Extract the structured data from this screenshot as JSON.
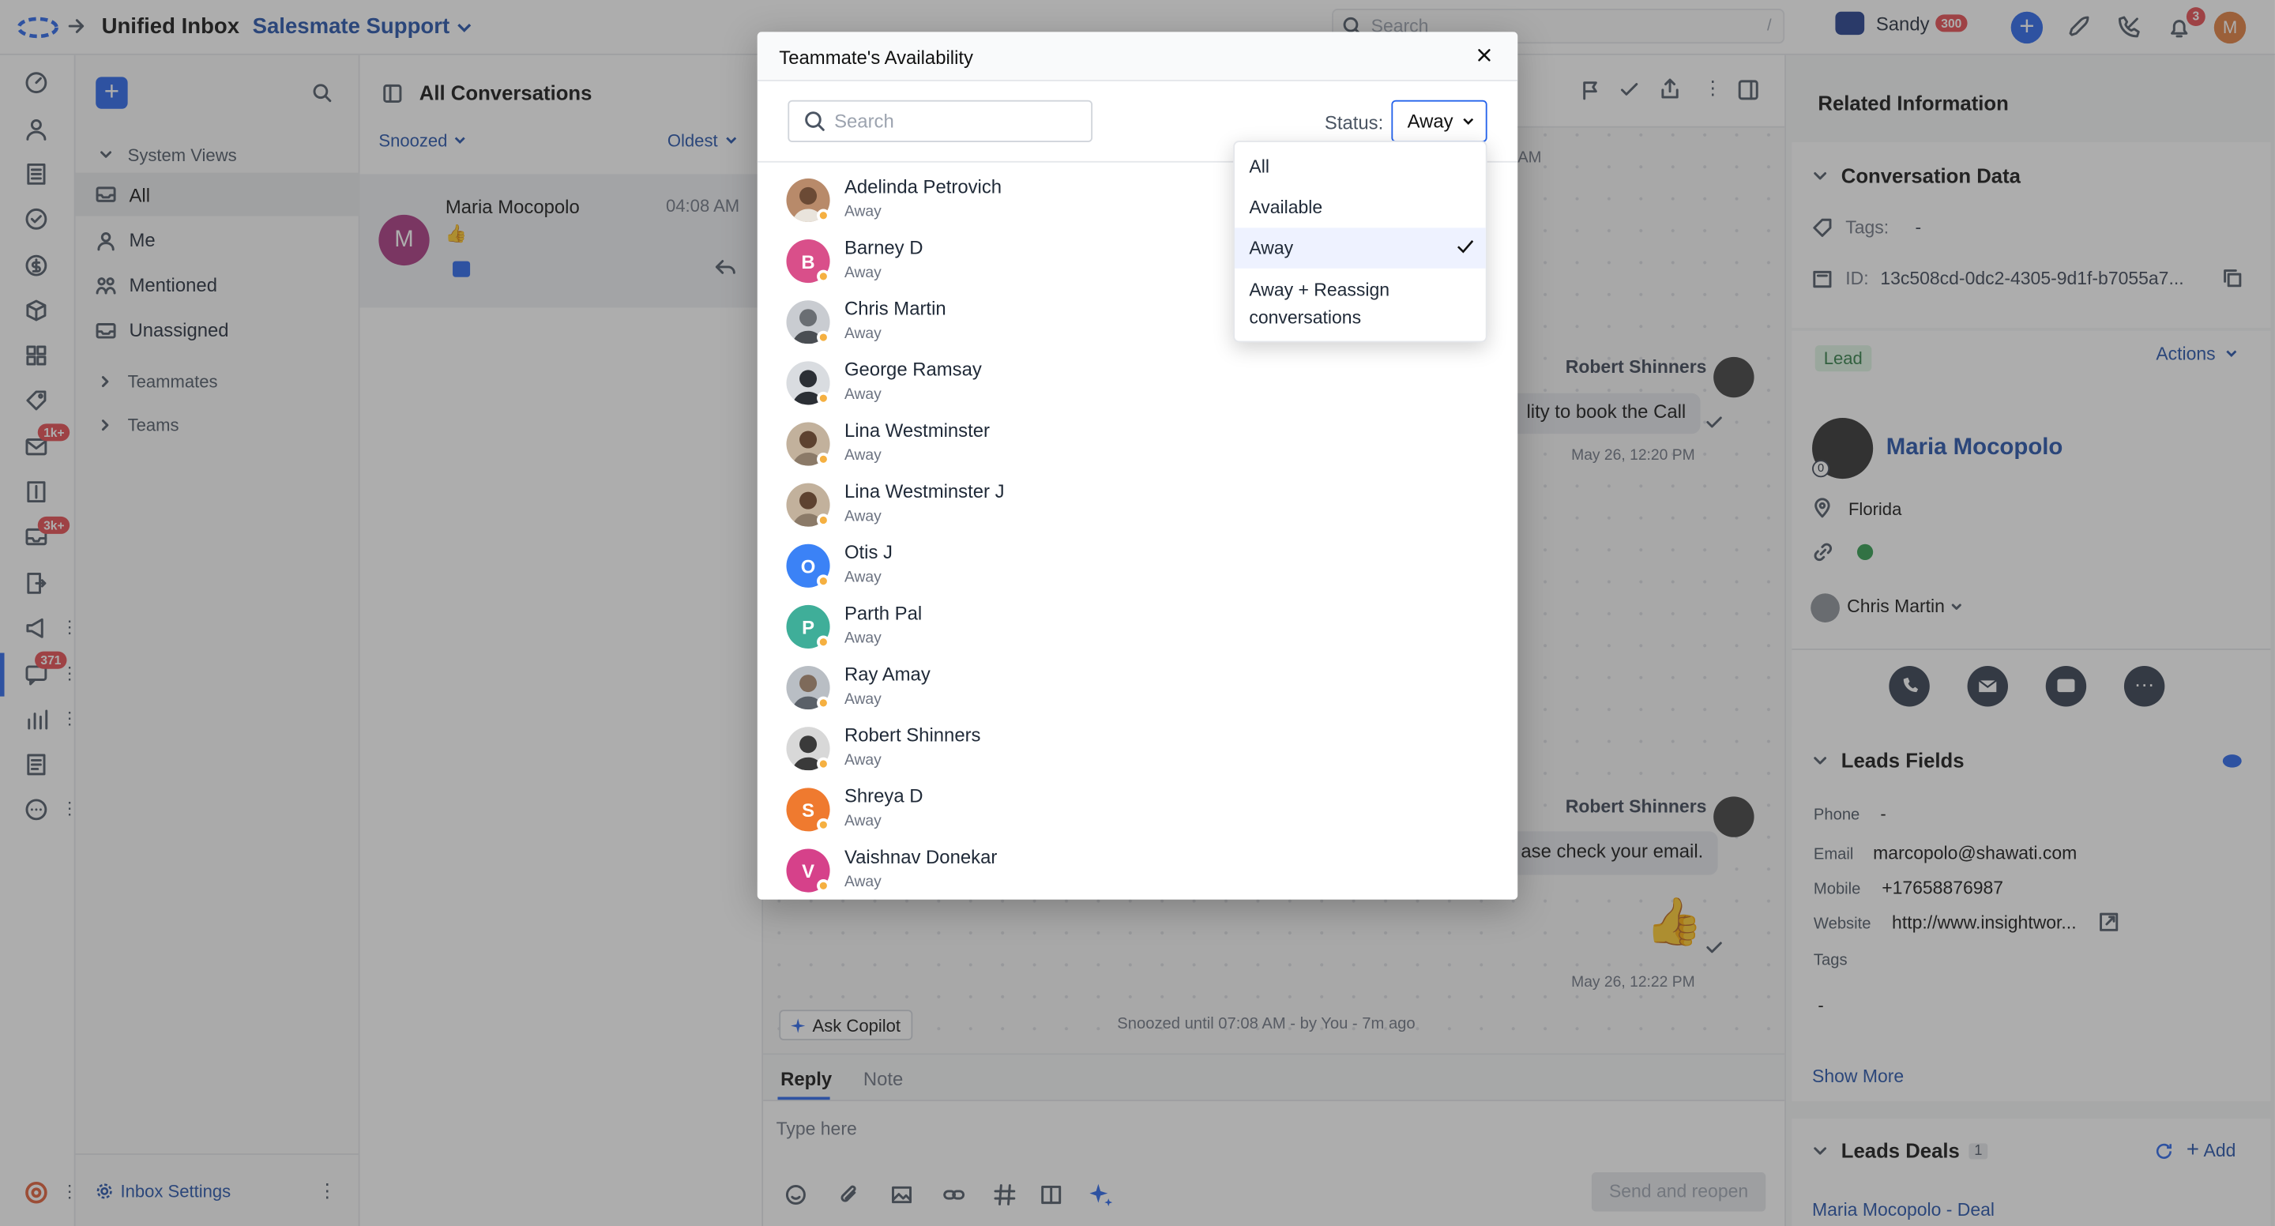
{
  "topbar": {
    "title": "Unified Inbox",
    "workspace": "Salesmate Support",
    "search_placeholder": "Search",
    "search_shortcut": "/",
    "user_name": "Sandy",
    "user_badge": "300",
    "notif_count": "3",
    "avatar_letter": "M"
  },
  "rail": {
    "badges": {
      "mail": "1k+",
      "inbox2": "3k+",
      "chat": "371"
    }
  },
  "sidebar": {
    "system_views_label": "System Views",
    "items": [
      {
        "label": "All"
      },
      {
        "label": "Me"
      },
      {
        "label": "Mentioned"
      },
      {
        "label": "Unassigned"
      }
    ],
    "groups": [
      {
        "label": "Teammates"
      },
      {
        "label": "Teams"
      }
    ],
    "settings_label": "Inbox Settings"
  },
  "convlist": {
    "title": "All Conversations",
    "filter": "Snoozed",
    "sort": "Oldest",
    "conversation": {
      "name": "Maria Mocopolo",
      "time": "04:08 AM",
      "preview": "👍",
      "avatar_letter": "M"
    }
  },
  "chat": {
    "bg_time1": "AM",
    "msg1": {
      "sender": "Robert Shinners",
      "text": "lity to book the Call",
      "time": "May 26, 12:20 PM"
    },
    "msg2": {
      "sender": "Robert Shinners",
      "text": "ase check your email.",
      "emoji": "👍",
      "time": "May 26, 12:22 PM"
    },
    "copilot": "Ask Copilot",
    "snooze_note": "Snoozed until 07:08 AM - by You - 7m ago",
    "tabs": [
      "Reply",
      "Note"
    ],
    "placeholder": "Type here",
    "send_label": "Send and reopen"
  },
  "right": {
    "title": "Related Information",
    "conv_data_title": "Conversation Data",
    "tags_label": "Tags:",
    "tags_value": "-",
    "id_label": "ID:",
    "id_value": "13c508cd-0dc2-4305-9d1f-b7055a7...",
    "lead_badge": "Lead",
    "actions_label": "Actions",
    "contact_name": "Maria Mocopolo",
    "contact_avatar_badge": "0",
    "location": "Florida",
    "owner": "Chris Martin",
    "fields_title": "Leads Fields",
    "fields": [
      {
        "label": "Phone",
        "value": "-"
      },
      {
        "label": "Email",
        "value": "marcopolo@shawati.com"
      },
      {
        "label": "Mobile",
        "value": "+17658876987"
      },
      {
        "label": "Website",
        "value": "http://www.insightwor..."
      },
      {
        "label": "Tags",
        "value": "-"
      }
    ],
    "show_more": "Show More",
    "deals_title": "Leads Deals",
    "deals_count": "1",
    "add_label": "Add",
    "deal_name": "Maria Mocopolo - Deal"
  },
  "modal": {
    "title": "Teammate's Availability",
    "search_placeholder": "Search",
    "status_label": "Status:",
    "status_value": "Away",
    "members": [
      {
        "name": "Adelinda Petrovich",
        "status": "Away",
        "avatar": "photo",
        "color": "#b88a6a"
      },
      {
        "name": "Barney D",
        "status": "Away",
        "avatar": "B",
        "color": "#d94f8a"
      },
      {
        "name": "Chris Martin",
        "status": "Away",
        "avatar": "photo",
        "color": "#8a8f96"
      },
      {
        "name": "George Ramsay",
        "status": "Away",
        "avatar": "photo",
        "color": "#3f4650"
      },
      {
        "name": "Lina Westminster",
        "status": "Away",
        "avatar": "photo",
        "color": "#a58768"
      },
      {
        "name": "Lina Westminster J",
        "status": "Away",
        "avatar": "photo",
        "color": "#a58768"
      },
      {
        "name": "Otis J",
        "status": "Away",
        "avatar": "O",
        "color": "#3b82f6"
      },
      {
        "name": "Parth Pal",
        "status": "Away",
        "avatar": "P",
        "color": "#3fae99"
      },
      {
        "name": "Ray Amay",
        "status": "Away",
        "avatar": "photo",
        "color": "#7e8791"
      },
      {
        "name": "Robert Shinners",
        "status": "Away",
        "avatar": "photo",
        "color": "#3a3a3a"
      },
      {
        "name": "Shreya D",
        "status": "Away",
        "avatar": "S",
        "color": "#ef7a2f"
      },
      {
        "name": "Vaishnav Donekar",
        "status": "Away",
        "avatar": "V",
        "color": "#d6418a"
      }
    ],
    "dropdown": {
      "options": [
        "All",
        "Available",
        "Away",
        "Away + Reassign conversations"
      ],
      "selected": "Away"
    }
  }
}
